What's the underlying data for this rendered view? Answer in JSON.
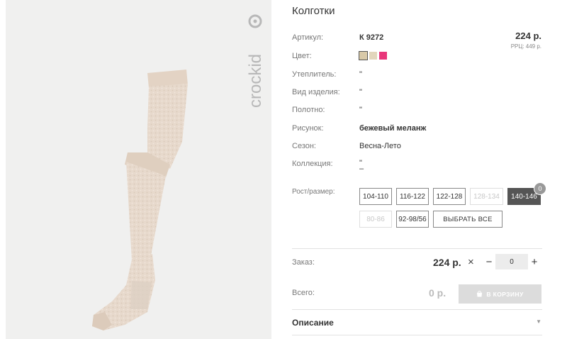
{
  "product": {
    "title": "Колготки",
    "price": "224 р.",
    "rrp": "РРЦ: 449 р."
  },
  "attributes": {
    "article": {
      "label": "Артикул:",
      "value": "К 9272"
    },
    "color": {
      "label": "Цвет:"
    },
    "insulation": {
      "label": "Утеплитель:",
      "value": "\""
    },
    "item_type": {
      "label": "Вид изделия:",
      "value": "\""
    },
    "fabric": {
      "label": "Полотно:",
      "value": "\""
    },
    "pattern": {
      "label": "Рисунок:",
      "value": "бежевый меланж"
    },
    "season": {
      "label": "Сезон:",
      "value": "Весна-Лето"
    },
    "collection": {
      "label": "Коллекция:",
      "value": "\"",
      "value2": "–"
    }
  },
  "colors": [
    {
      "name": "beige-dark",
      "hex": "#d8c9a8",
      "selected": true
    },
    {
      "name": "beige-light",
      "hex": "#e2d6bc",
      "selected": false
    },
    {
      "name": "pink",
      "hex": "#e8367a",
      "selected": false
    }
  ],
  "sizes": {
    "label": "Рост/размер:",
    "options": [
      {
        "label": "104-110",
        "state": "normal"
      },
      {
        "label": "116-122",
        "state": "normal"
      },
      {
        "label": "122-128",
        "state": "normal"
      },
      {
        "label": "128-134",
        "state": "disabled"
      },
      {
        "label": "140-146",
        "state": "active"
      },
      {
        "label": "80-86",
        "state": "disabled"
      },
      {
        "label": "92-98/56",
        "state": "normal"
      }
    ],
    "select_all_label": "ВЫБРАТЬ ВСЕ",
    "badge_count": "0"
  },
  "order": {
    "label": "Заказ:",
    "price": "224 р.",
    "times_symbol": "×",
    "minus": "−",
    "plus": "+",
    "quantity": "0"
  },
  "total": {
    "label": "Всего:",
    "value": "0 р.",
    "cart_button_label": "В КОРЗИНУ"
  },
  "description": {
    "title": "Описание",
    "toggle_icon": "▼"
  },
  "brand": {
    "logo_text": "crockid"
  },
  "icons": {
    "cart": "bag-icon",
    "expand": "chevron-down-icon",
    "logo": "crockid-logo-icon"
  }
}
